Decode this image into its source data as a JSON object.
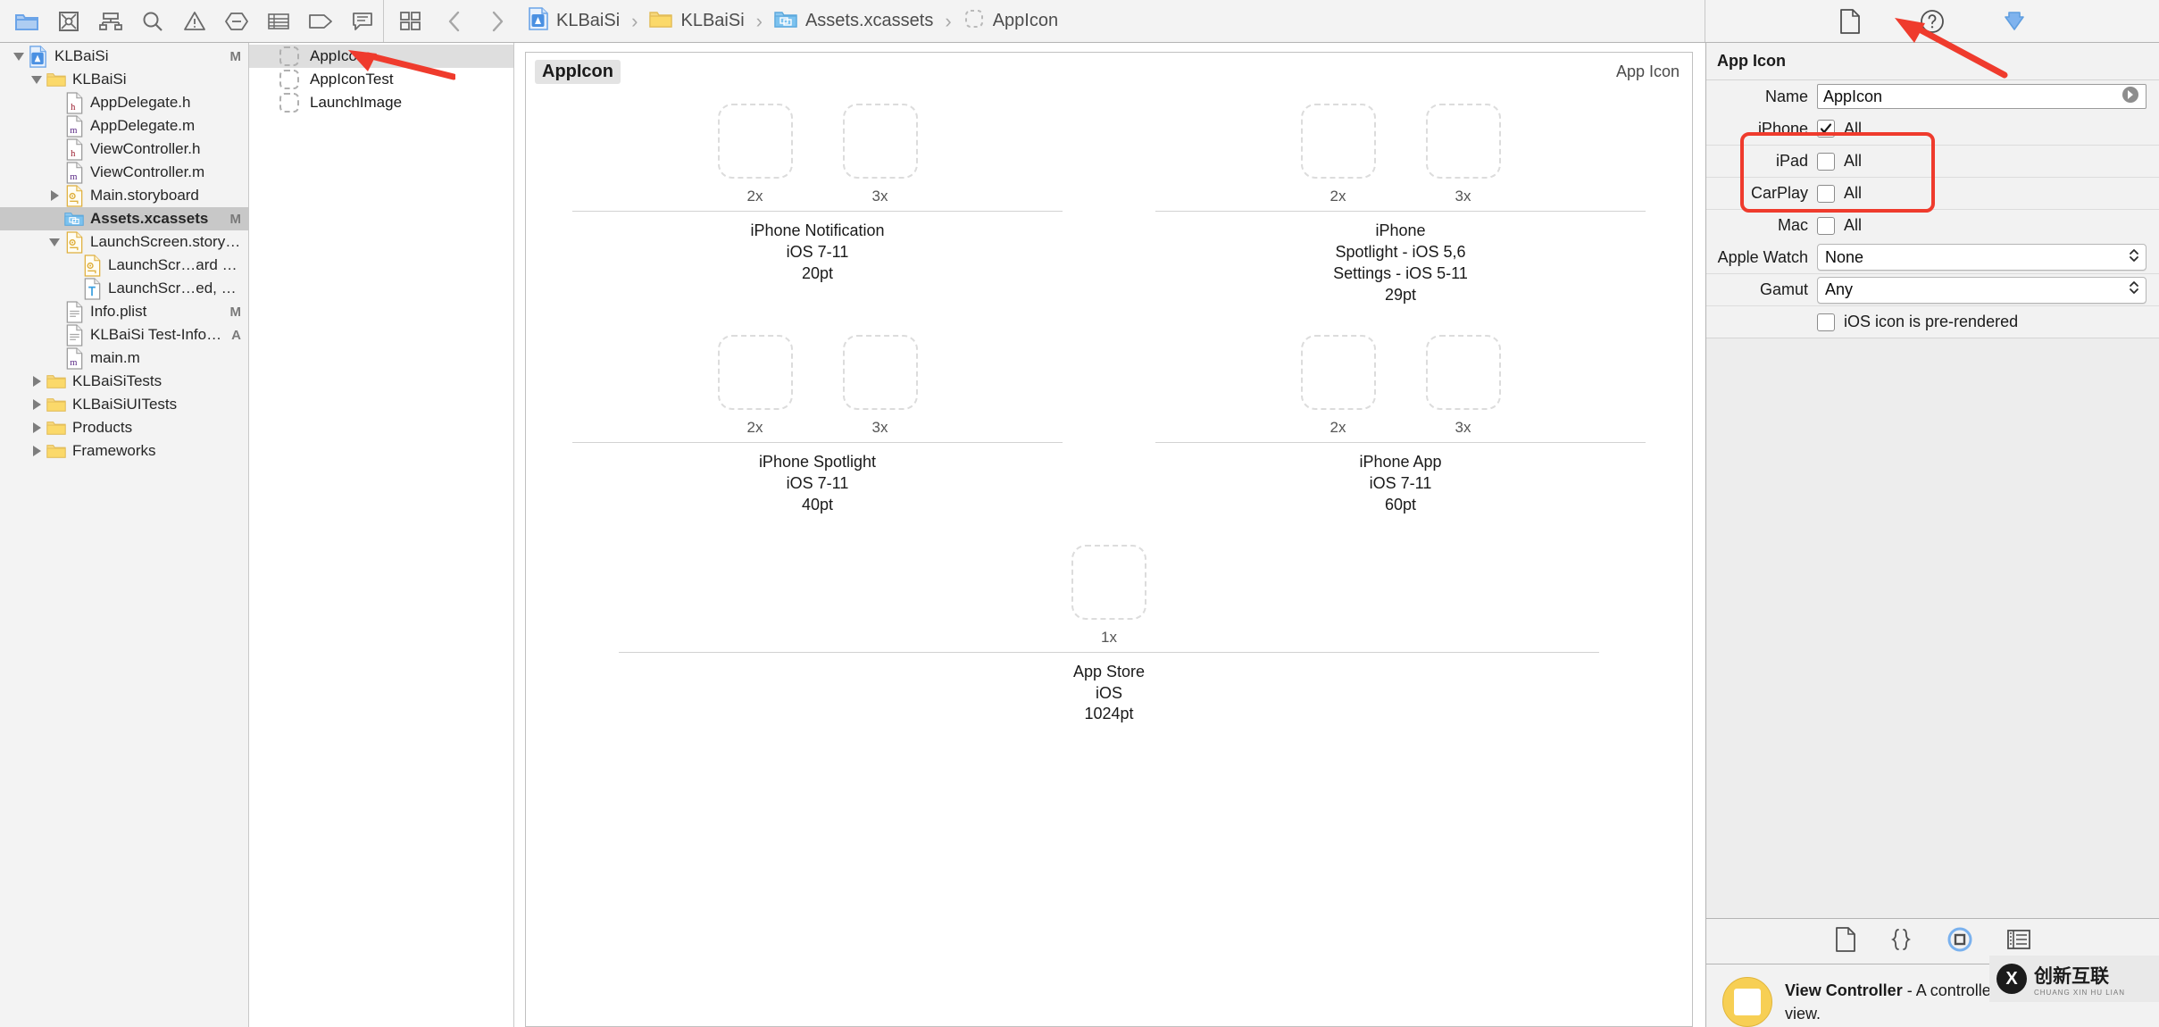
{
  "toolbar": {
    "left_icons": [
      {
        "name": "folder-icon",
        "label": "Project navigator"
      },
      {
        "name": "source-control-icon",
        "label": "Source control navigator"
      },
      {
        "name": "symbol-hierarchy-icon",
        "label": "Symbol navigator"
      },
      {
        "name": "search-icon",
        "label": "Find navigator"
      },
      {
        "name": "warning-triangle-icon",
        "label": "Issue navigator"
      },
      {
        "name": "test-diamond-icon",
        "label": "Test navigator"
      },
      {
        "name": "debug-list-icon",
        "label": "Debug navigator"
      },
      {
        "name": "breakpoint-tag-icon",
        "label": "Breakpoint navigator"
      },
      {
        "name": "report-speech-icon",
        "label": "Report navigator"
      }
    ],
    "mid_icons": [
      {
        "name": "related-items-icon",
        "label": "Related items"
      },
      {
        "name": "back-chevron-icon",
        "label": "Back"
      },
      {
        "name": "forward-chevron-icon",
        "label": "Forward"
      }
    ],
    "breadcrumb": [
      {
        "icon": "xcode-project-icon",
        "label": "KLBaiSi"
      },
      {
        "icon": "folder-icon",
        "label": "KLBaiSi"
      },
      {
        "icon": "assets-catalog-icon",
        "label": "Assets.xcassets"
      },
      {
        "icon": "appicon-placeholder-icon",
        "label": "AppIcon"
      }
    ],
    "separator": "›",
    "right_icons": [
      {
        "name": "file-inspector-icon",
        "label": "File inspector"
      },
      {
        "name": "quick-help-icon",
        "label": "Quick Help inspector"
      },
      {
        "name": "attributes-inspector-icon",
        "label": "Attributes inspector",
        "active": true
      }
    ]
  },
  "navigator": {
    "items": [
      {
        "depth": 0,
        "twisty": "down",
        "icon": "xcode-project-icon",
        "label": "KLBaiSi",
        "status": "M",
        "selected": false
      },
      {
        "depth": 1,
        "twisty": "down",
        "icon": "folder-icon",
        "label": "KLBaiSi",
        "status": "",
        "selected": false
      },
      {
        "depth": 2,
        "twisty": "",
        "icon": "header-file-icon",
        "label": "AppDelegate.h",
        "status": "",
        "selected": false
      },
      {
        "depth": 2,
        "twisty": "",
        "icon": "objc-file-icon",
        "label": "AppDelegate.m",
        "status": "",
        "selected": false
      },
      {
        "depth": 2,
        "twisty": "",
        "icon": "header-file-icon",
        "label": "ViewController.h",
        "status": "",
        "selected": false
      },
      {
        "depth": 2,
        "twisty": "",
        "icon": "objc-file-icon",
        "label": "ViewController.m",
        "status": "",
        "selected": false
      },
      {
        "depth": 2,
        "twisty": "right",
        "icon": "storyboard-file-icon",
        "label": "Main.storyboard",
        "status": "",
        "selected": false
      },
      {
        "depth": 2,
        "twisty": "",
        "icon": "assets-catalog-icon",
        "label": "Assets.xcassets",
        "status": "M",
        "selected": true
      },
      {
        "depth": 2,
        "twisty": "down",
        "icon": "storyboard-file-icon",
        "label": "LaunchScreen.storyboard",
        "status": "",
        "selected": false
      },
      {
        "depth": 3,
        "twisty": "",
        "icon": "storyboard-file-icon",
        "label": "LaunchScr…ard (Base)",
        "status": "",
        "selected": false
      },
      {
        "depth": 3,
        "twisty": "",
        "icon": "strings-file-icon",
        "label": "LaunchScr…ed, China))",
        "status": "",
        "selected": false
      },
      {
        "depth": 2,
        "twisty": "",
        "icon": "plist-file-icon",
        "label": "Info.plist",
        "status": "M",
        "selected": false
      },
      {
        "depth": 2,
        "twisty": "",
        "icon": "plist-file-icon",
        "label": "KLBaiSi Test-Info.plist",
        "status": "A",
        "selected": false
      },
      {
        "depth": 2,
        "twisty": "",
        "icon": "objc-file-icon",
        "label": "main.m",
        "status": "",
        "selected": false
      },
      {
        "depth": 1,
        "twisty": "right",
        "icon": "folder-icon",
        "label": "KLBaiSiTests",
        "status": "",
        "selected": false
      },
      {
        "depth": 1,
        "twisty": "right",
        "icon": "folder-icon",
        "label": "KLBaiSiUITests",
        "status": "",
        "selected": false
      },
      {
        "depth": 1,
        "twisty": "right",
        "icon": "folder-icon",
        "label": "Products",
        "status": "",
        "selected": false
      },
      {
        "depth": 1,
        "twisty": "right",
        "icon": "folder-icon",
        "label": "Frameworks",
        "status": "",
        "selected": false
      }
    ]
  },
  "asset_list": {
    "items": [
      {
        "label": "AppIcon",
        "selected": true
      },
      {
        "label": "AppIconTest",
        "selected": false
      },
      {
        "label": "LaunchImage",
        "selected": false
      }
    ]
  },
  "detail": {
    "title": "AppIcon",
    "kind": "App Icon",
    "cells": [
      {
        "name": "iPhone Notification\niOS 7-11\n20pt",
        "name_lines": [
          "iPhone Notification",
          "iOS 7-11",
          "20pt"
        ],
        "slots": [
          {
            "scale": "2x",
            "size": 84
          },
          {
            "scale": "3x",
            "size": 84
          }
        ]
      },
      {
        "name_lines": [
          "iPhone",
          "Spotlight - iOS 5,6",
          "Settings - iOS 5-11",
          "29pt"
        ],
        "slots": [
          {
            "scale": "2x",
            "size": 84
          },
          {
            "scale": "3x",
            "size": 84
          }
        ]
      },
      {
        "name_lines": [
          "iPhone Spotlight",
          "iOS 7-11",
          "40pt"
        ],
        "slots": [
          {
            "scale": "2x",
            "size": 84
          },
          {
            "scale": "3x",
            "size": 84
          }
        ]
      },
      {
        "name_lines": [
          "iPhone App",
          "iOS 7-11",
          "60pt"
        ],
        "slots": [
          {
            "scale": "2x",
            "size": 84
          },
          {
            "scale": "3x",
            "size": 84
          }
        ]
      },
      {
        "name_lines": [
          "App Store",
          "iOS",
          "1024pt"
        ],
        "full_width": true,
        "slots": [
          {
            "scale": "1x",
            "size": 84
          }
        ]
      }
    ]
  },
  "inspector": {
    "title": "App Icon",
    "name_label": "Name",
    "name_value": "AppIcon",
    "devices": [
      {
        "label": "iPhone",
        "checked": true,
        "text": "All"
      },
      {
        "label": "iPad",
        "checked": false,
        "text": "All"
      },
      {
        "label": "CarPlay",
        "checked": false,
        "text": "All"
      },
      {
        "label": "Mac",
        "checked": false,
        "text": "All"
      }
    ],
    "apple_watch_label": "Apple Watch",
    "apple_watch_value": "None",
    "gamut_label": "Gamut",
    "gamut_value": "Any",
    "prerendered_label": "iOS icon is pre-rendered",
    "prerendered_checked": false
  },
  "library": {
    "tabs": [
      {
        "name": "file-template-library-icon",
        "active": false
      },
      {
        "name": "code-snippet-library-icon",
        "active": false
      },
      {
        "name": "object-library-icon",
        "active": true
      },
      {
        "name": "media-library-icon",
        "active": false
      }
    ],
    "item_title": "View Controller",
    "item_desc": " - A controller that manages a view."
  },
  "watermark": {
    "badge": "X",
    "line1": "创新互联",
    "line2": "CHUANG XIN HU LIAN"
  },
  "colors": {
    "accent_blue": "#6ba4e8",
    "selection_gray": "#c8c8c8",
    "annotation_red": "#ef3b2d",
    "toolbar_bg": "#f3f3f3"
  }
}
